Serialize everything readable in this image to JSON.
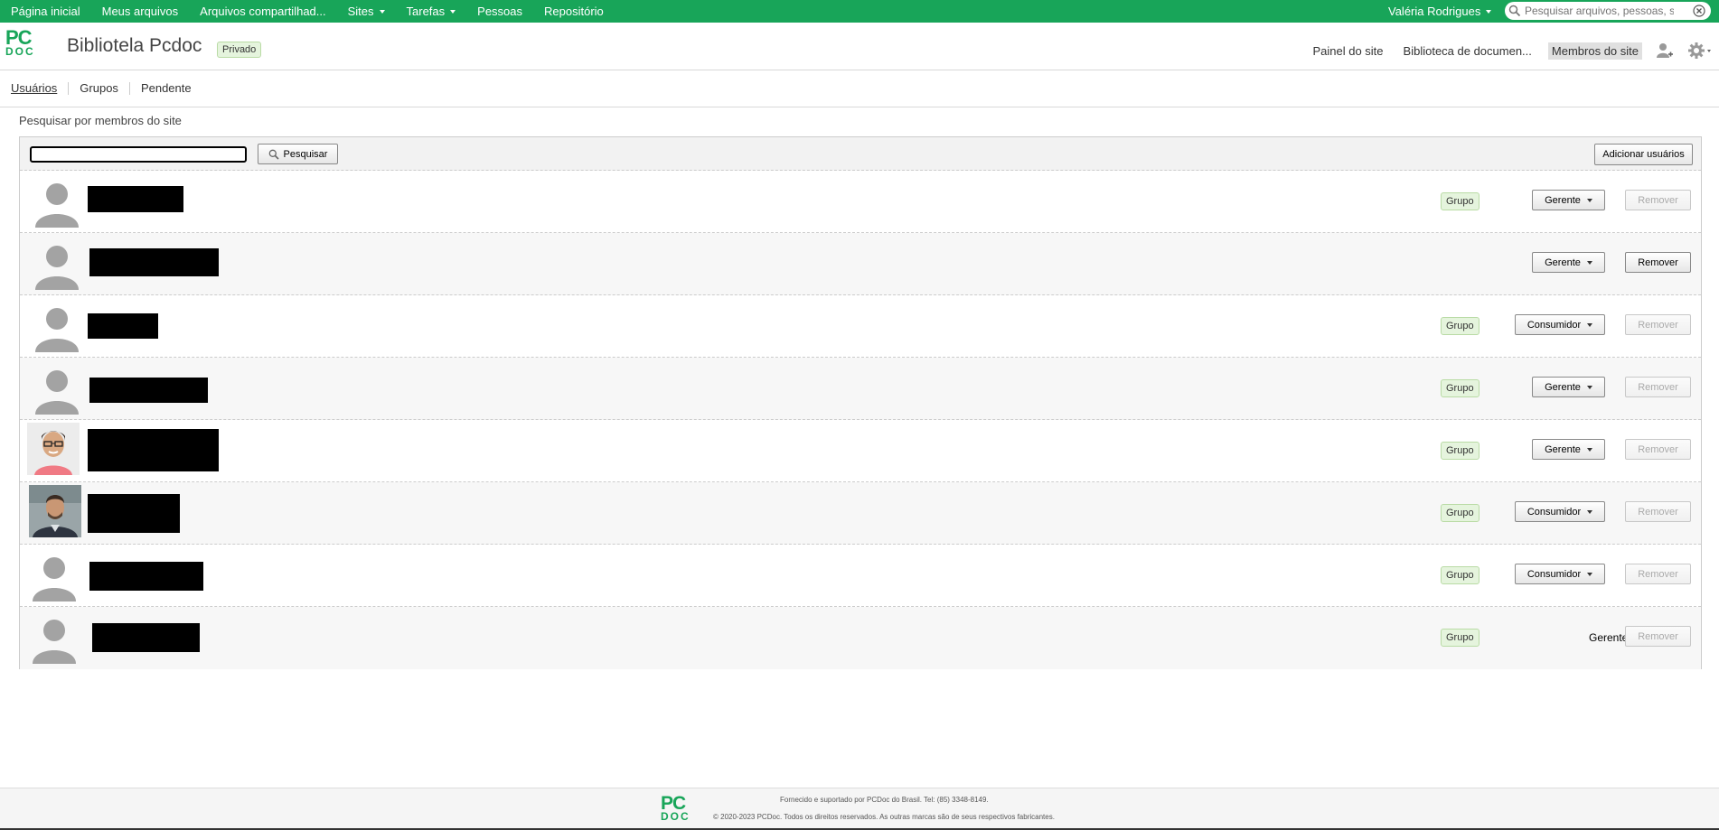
{
  "topnav": {
    "items": [
      {
        "label": "Página inicial",
        "dropdown": false
      },
      {
        "label": "Meus arquivos",
        "dropdown": false
      },
      {
        "label": "Arquivos compartilhad...",
        "dropdown": false
      },
      {
        "label": "Sites",
        "dropdown": true
      },
      {
        "label": "Tarefas",
        "dropdown": true
      },
      {
        "label": "Pessoas",
        "dropdown": false
      },
      {
        "label": "Repositório",
        "dropdown": false
      }
    ],
    "user": "Valéria Rodrigues",
    "search_placeholder": "Pesquisar arquivos, pessoas, sites"
  },
  "brand": {
    "logo_top": "PC",
    "logo_bottom": "DOC",
    "color": "#18a559"
  },
  "site": {
    "title": "Bibliotela Pcdoc",
    "visibility": "Privado",
    "nav": [
      "Painel do site",
      "Biblioteca de documen...",
      "Membros do site"
    ],
    "active_nav": "Membros do site"
  },
  "tabs": [
    {
      "label": "Usuários",
      "active": true
    },
    {
      "label": "Grupos",
      "active": false
    },
    {
      "label": "Pendente",
      "active": false
    }
  ],
  "members_panel": {
    "section_label": "Pesquisar por membros do site",
    "search_value": "",
    "search_button": "Pesquisar",
    "add_button": "Adicionar usuários"
  },
  "members": [
    {
      "avatar": "default",
      "name": "",
      "grupo": "Grupo",
      "role": "Gerente",
      "role_editable": true,
      "remove": "Remover",
      "remove_enabled": false
    },
    {
      "avatar": "default",
      "name": "",
      "grupo": "",
      "role": "Gerente",
      "role_editable": true,
      "remove": "Remover",
      "remove_enabled": true
    },
    {
      "avatar": "default",
      "name": "",
      "grupo": "Grupo",
      "role": "Consumidor",
      "role_editable": true,
      "remove": "Remover",
      "remove_enabled": false
    },
    {
      "avatar": "default",
      "name": "",
      "grupo": "Grupo",
      "role": "Gerente",
      "role_editable": true,
      "remove": "Remover",
      "remove_enabled": false
    },
    {
      "avatar": "photo-woman",
      "name": "",
      "grupo": "Grupo",
      "role": "Gerente",
      "role_editable": true,
      "remove": "Remover",
      "remove_enabled": false
    },
    {
      "avatar": "photo-man",
      "name": "",
      "grupo": "Grupo",
      "role": "Consumidor",
      "role_editable": true,
      "remove": "Remover",
      "remove_enabled": false
    },
    {
      "avatar": "default",
      "name": "",
      "grupo": "Grupo",
      "role": "Consumidor",
      "role_editable": true,
      "remove": "Remover",
      "remove_enabled": false
    },
    {
      "avatar": "default",
      "name": "",
      "grupo": "Grupo",
      "role": "Gerente",
      "role_editable": false,
      "remove": "Remover",
      "remove_enabled": false
    }
  ],
  "footer": {
    "line1": "Fornecido e suportado por PCDoc do Brasil. Tel: (85) 3348-8149.",
    "line2": "© 2020-2023 PCDoc. Todos os direitos reservados. As outras marcas são de seus respectivos fabricantes."
  }
}
